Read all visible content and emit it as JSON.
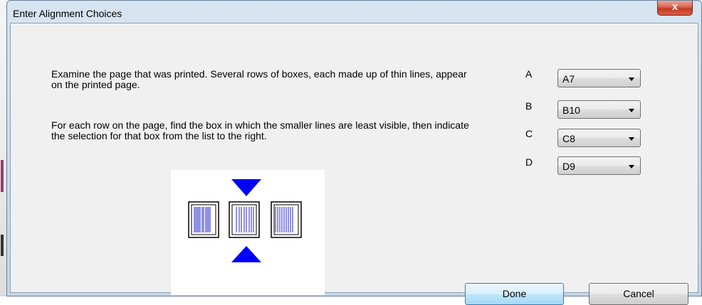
{
  "window": {
    "title": "Enter Alignment Choices",
    "close_label": "x"
  },
  "instructions": {
    "para1": "Examine the page that was printed. Several rows of boxes, each made up of thin lines, appear on the printed page.",
    "para2": "For each row on the page, find the box in which the smaller lines are least visible, then indicate the selection for that box from the list to the right."
  },
  "diagram": {
    "icon": "alignment-pattern-icon",
    "marker_color": "#0000ff",
    "line_color": "#2222cc"
  },
  "choices": [
    {
      "label": "A",
      "value": "A7"
    },
    {
      "label": "B",
      "value": "B10"
    },
    {
      "label": "C",
      "value": "C8"
    },
    {
      "label": "D",
      "value": "D9"
    }
  ],
  "buttons": {
    "done": "Done",
    "cancel": "Cancel"
  }
}
